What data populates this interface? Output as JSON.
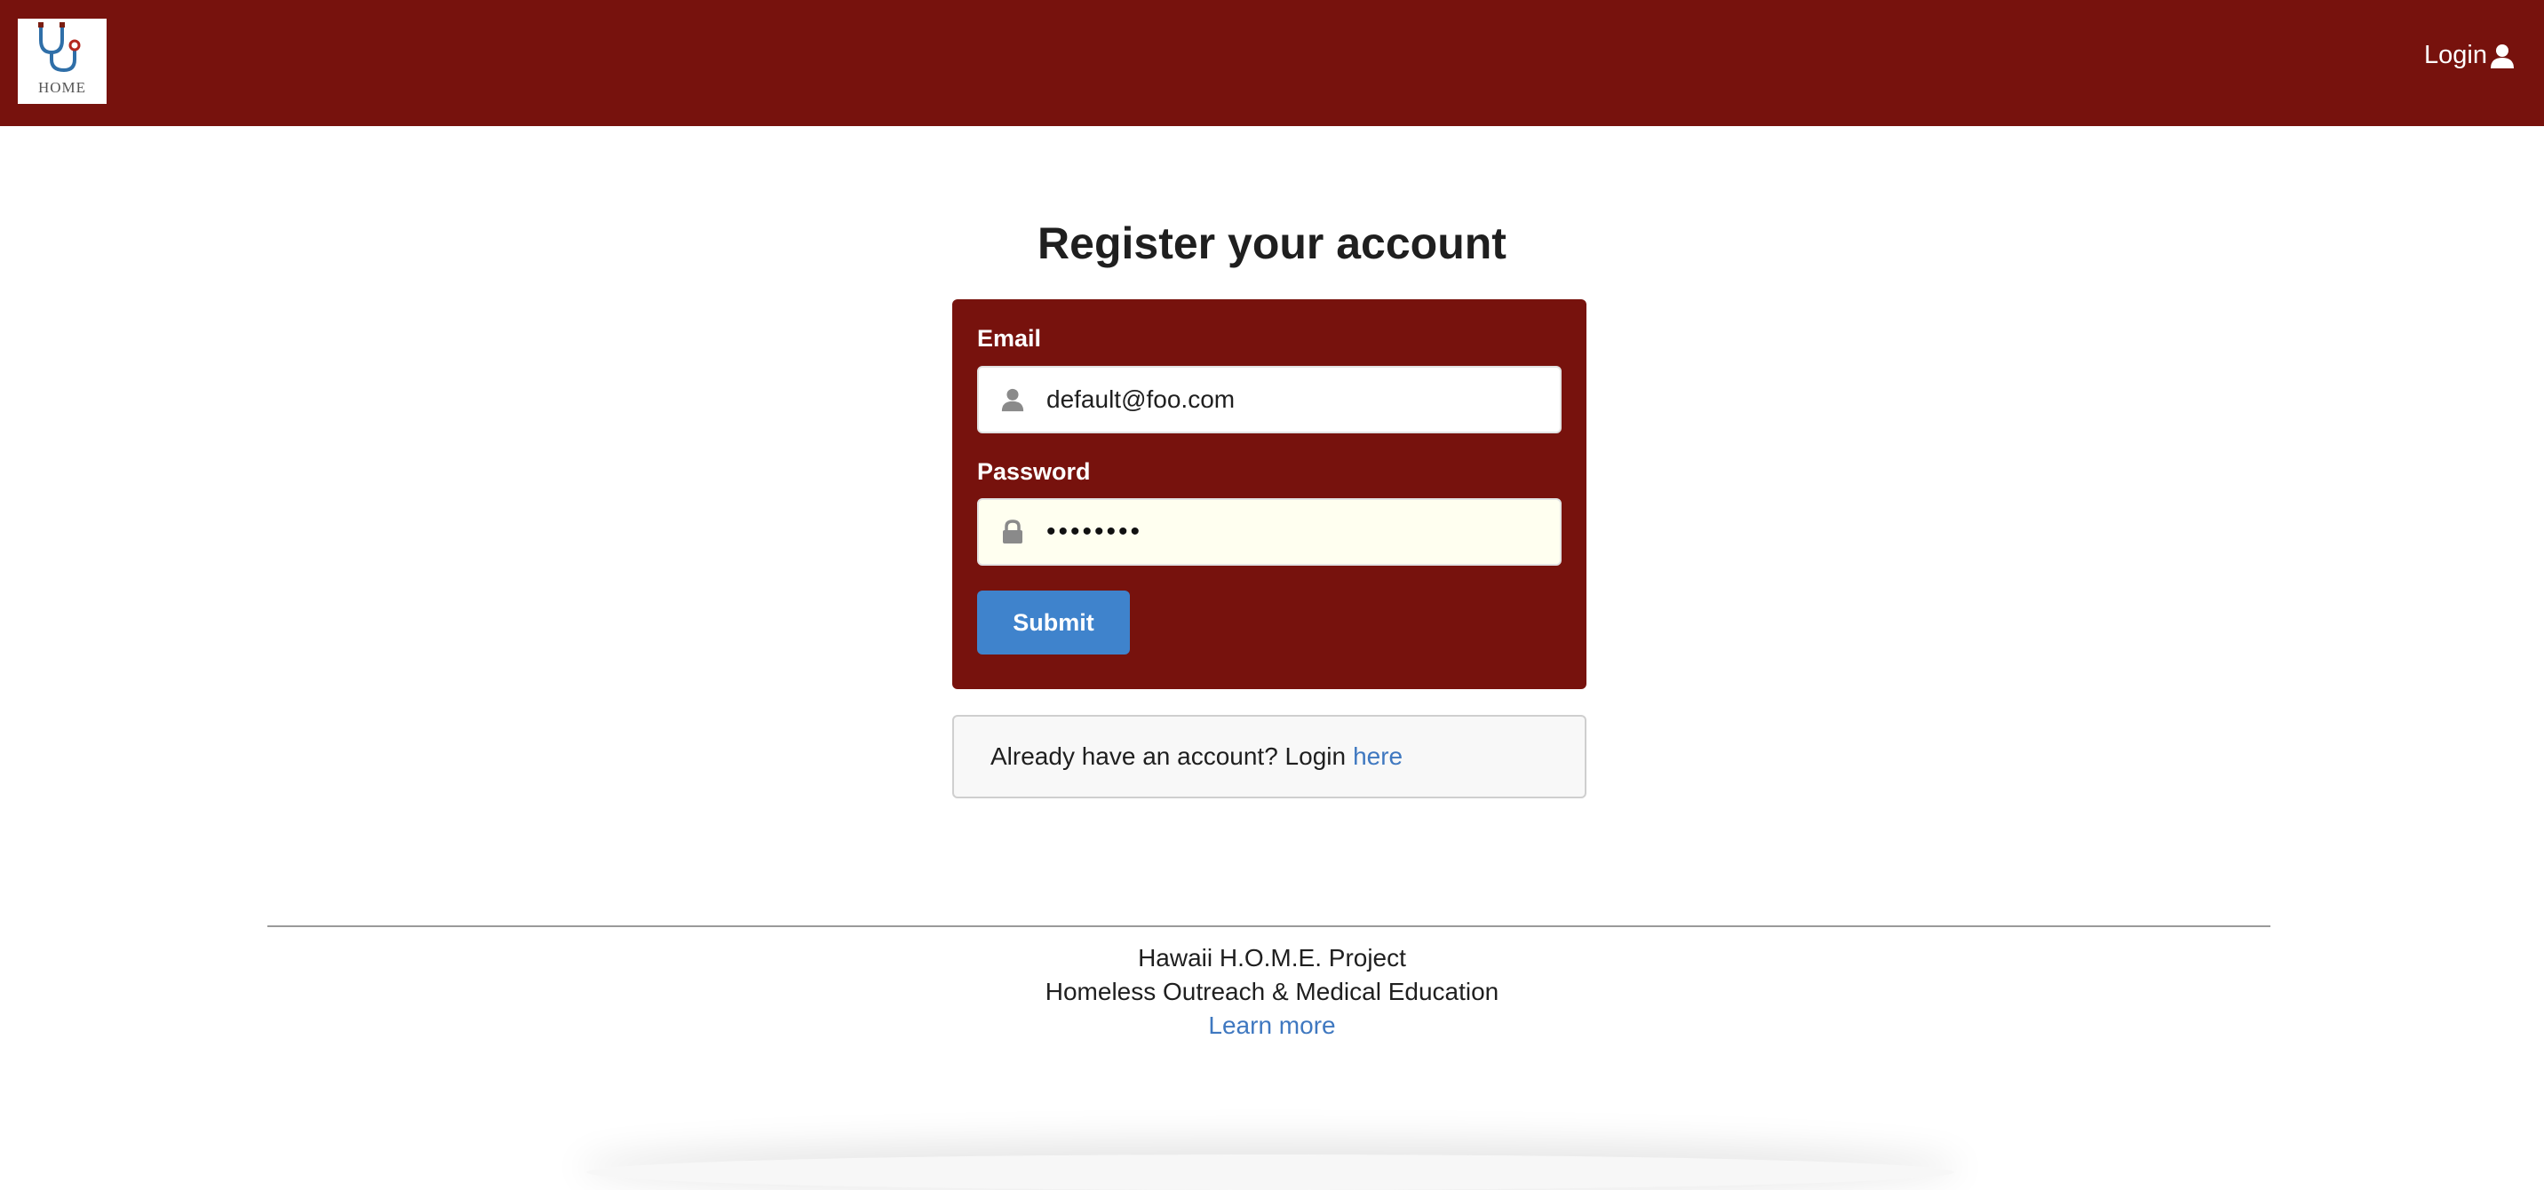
{
  "nav": {
    "logo_text": "HOME",
    "login_label": "Login"
  },
  "page": {
    "title": "Register your account"
  },
  "form": {
    "email_label": "Email",
    "email_value": "default@foo.com",
    "password_label": "Password",
    "password_masked": "••••••••",
    "submit_label": "Submit"
  },
  "login_prompt": {
    "text": "Already have an account? Login",
    "link_label": "here"
  },
  "footer": {
    "line1": "Hawaii H.O.M.E. Project",
    "line2": "Homeless Outreach & Medical Education",
    "link_label": "Learn more"
  },
  "colors": {
    "brand": "#77120d",
    "button": "#3f83cc",
    "link": "#3f78c0"
  },
  "icons": {
    "logo": "stethoscope-icon",
    "nav_login": "user-icon",
    "email": "user-icon",
    "password": "lock-icon"
  }
}
